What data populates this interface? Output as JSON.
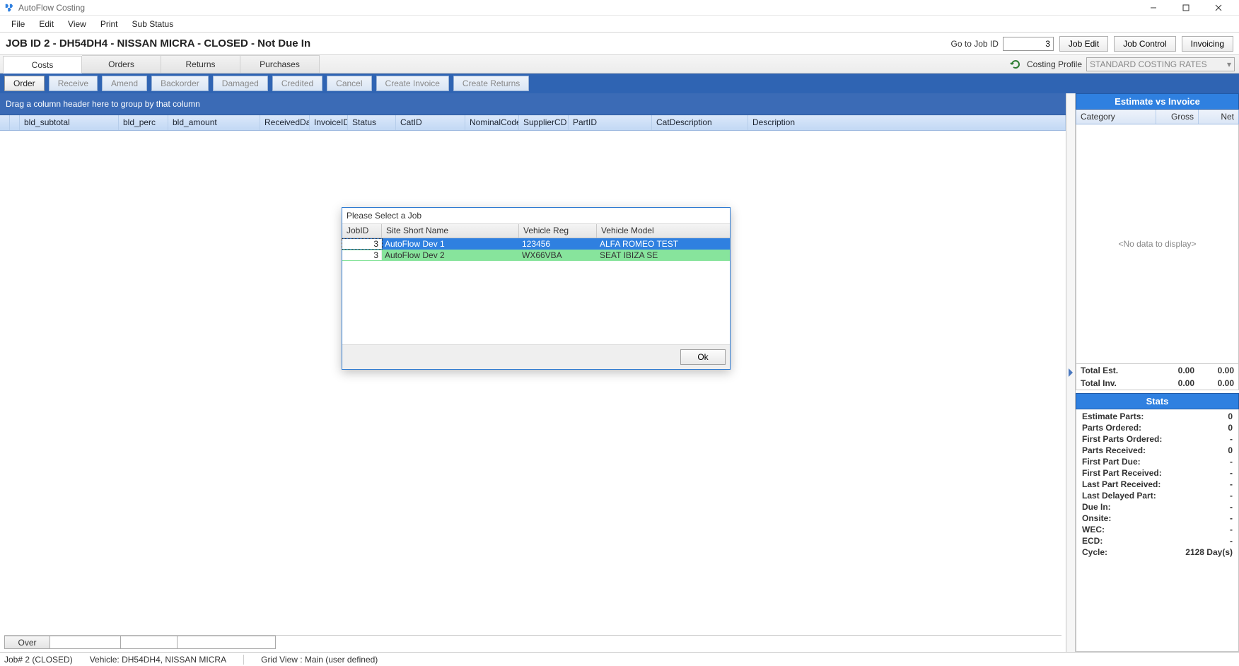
{
  "window": {
    "title": "AutoFlow Costing"
  },
  "menu": [
    "File",
    "Edit",
    "View",
    "Print",
    "Sub Status"
  ],
  "header": {
    "title": "JOB ID 2 - DH54DH4 - NISSAN MICRA - CLOSED - Not Due In",
    "go_label": "Go to Job ID",
    "go_value": "3",
    "btn_job_edit": "Job Edit",
    "btn_job_control": "Job Control",
    "btn_invoicing": "Invoicing"
  },
  "tabs": {
    "items": [
      "Costs",
      "Orders",
      "Returns",
      "Purchases"
    ],
    "active": 0
  },
  "costing_profile": {
    "label": "Costing Profile",
    "value": "STANDARD COSTING RATES"
  },
  "actions": {
    "order": "Order",
    "receive": "Receive",
    "amend": "Amend",
    "backorder": "Backorder",
    "damaged": "Damaged",
    "credited": "Credited",
    "cancel": "Cancel",
    "create_invoice": "Create Invoice",
    "create_returns": "Create Returns"
  },
  "grid": {
    "group_text": "Drag a column header here to group by that column",
    "columns": [
      "bld_subtotal",
      "bld_perc",
      "bld_amount",
      "ReceivedDate",
      "InvoiceID",
      "Status",
      "CatID",
      "NominalCode",
      "SupplierCD",
      "PartID",
      "CatDescription",
      "Description"
    ]
  },
  "over": {
    "label": "Over"
  },
  "evi": {
    "title": "Estimate vs Invoice",
    "cols": [
      "Category",
      "Gross",
      "Net"
    ],
    "empty": "<No data to display>",
    "total_est_label": "Total Est.",
    "total_inv_label": "Total Inv.",
    "total_est_gross": "0.00",
    "total_est_net": "0.00",
    "total_inv_gross": "0.00",
    "total_inv_net": "0.00"
  },
  "stats": {
    "title": "Stats",
    "rows": [
      {
        "label": "Estimate Parts:",
        "value": "0"
      },
      {
        "label": "Parts Ordered:",
        "value": "0"
      },
      {
        "label": "First Parts Ordered:",
        "value": "-"
      },
      {
        "label": "Parts Received:",
        "value": "0"
      },
      {
        "label": "First Part Due:",
        "value": "-"
      },
      {
        "label": "First Part Received:",
        "value": "-"
      },
      {
        "label": "Last Part Received:",
        "value": "-"
      },
      {
        "label": "Last Delayed Part:",
        "value": "-"
      },
      {
        "label": "Due In:",
        "value": "-"
      },
      {
        "label": "Onsite:",
        "value": "-"
      },
      {
        "label": "WEC:",
        "value": "-"
      },
      {
        "label": "ECD:",
        "value": "-"
      },
      {
        "label": "Cycle:",
        "value": "2128 Day(s)"
      }
    ]
  },
  "statusbar": {
    "job": "Job# 2 (CLOSED)",
    "vehicle": "Vehicle: DH54DH4, NISSAN MICRA",
    "gridview": "Grid View : Main (user defined)"
  },
  "dialog": {
    "title": "Please Select a Job",
    "cols": [
      "JobID",
      "Site Short Name",
      "Vehicle Reg",
      "Vehicle Model"
    ],
    "rows": [
      {
        "jobid": "3",
        "site": "AutoFlow Dev 1",
        "reg": "123456",
        "model": "ALFA ROMEO TEST"
      },
      {
        "jobid": "3",
        "site": "AutoFlow Dev 2",
        "reg": "WX66VBA",
        "model": "SEAT IBIZA SE"
      }
    ],
    "ok": "Ok"
  }
}
